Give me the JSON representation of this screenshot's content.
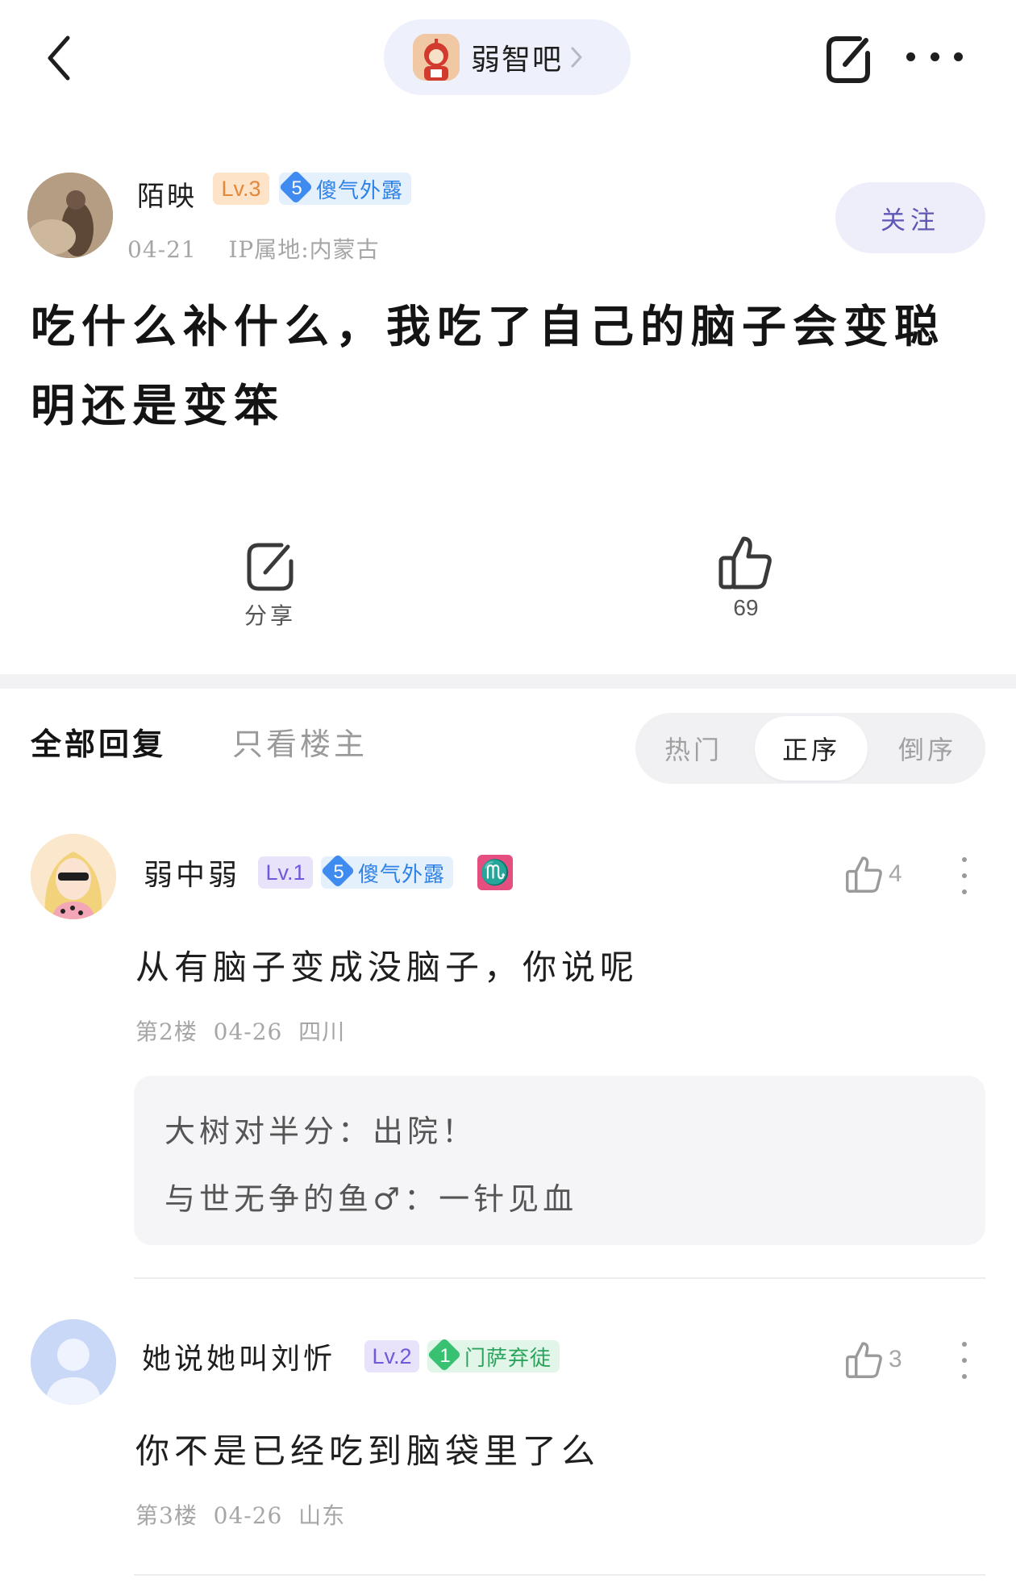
{
  "nav": {
    "forum_name": "弱智吧",
    "icon_back": "chevron-left-icon",
    "icon_edit": "edit-icon",
    "icon_more": "more-horizontal-icon"
  },
  "post": {
    "author": "陌映",
    "level": "Lv.3",
    "title_num": "5",
    "title_tag": "傻气外露",
    "date": "04-21",
    "ip_location": "IP属地:内蒙古",
    "follow_label": "关注",
    "title": "吃什么补什么，我吃了自己的脑子会变聪明还是变笨",
    "share_label": "分享",
    "like_count": "69"
  },
  "tabs": {
    "all": "全部回复",
    "op_only": "只看楼主",
    "sort": [
      "热门",
      "正序",
      "倒序"
    ],
    "sort_active": "正序"
  },
  "replies": [
    {
      "name": "弱中弱",
      "level": "Lv.1",
      "title_num": "5",
      "title_tag": "傻气外露",
      "zodiac": "♏",
      "likes": "4",
      "content": "从有脑子变成没脑子，你说呢",
      "floor": "第2楼",
      "date": "04-26",
      "location": "四川",
      "sub_replies": [
        {
          "user": "大树对半分",
          "sep": "：",
          "text": "出院！"
        },
        {
          "user": "与世无争的鱼♂",
          "sep": "：",
          "text": "一针见血"
        }
      ]
    },
    {
      "name": "她说她叫刘忻",
      "level": "Lv.2",
      "title_num": "1",
      "title_tag": "门萨弃徒",
      "likes": "3",
      "content": "你不是已经吃到脑袋里了么",
      "floor": "第3楼",
      "date": "04-26",
      "location": "山东"
    }
  ],
  "colors": {
    "accent": "#5e57b4",
    "pill_bg": "#eef1fc",
    "level_orange": "#e2883b",
    "level_purple": "#6e5ad8",
    "tag_blue": "#2f82e6",
    "tag_green": "#2aa35c",
    "zodiac_pink": "#e44f80"
  }
}
